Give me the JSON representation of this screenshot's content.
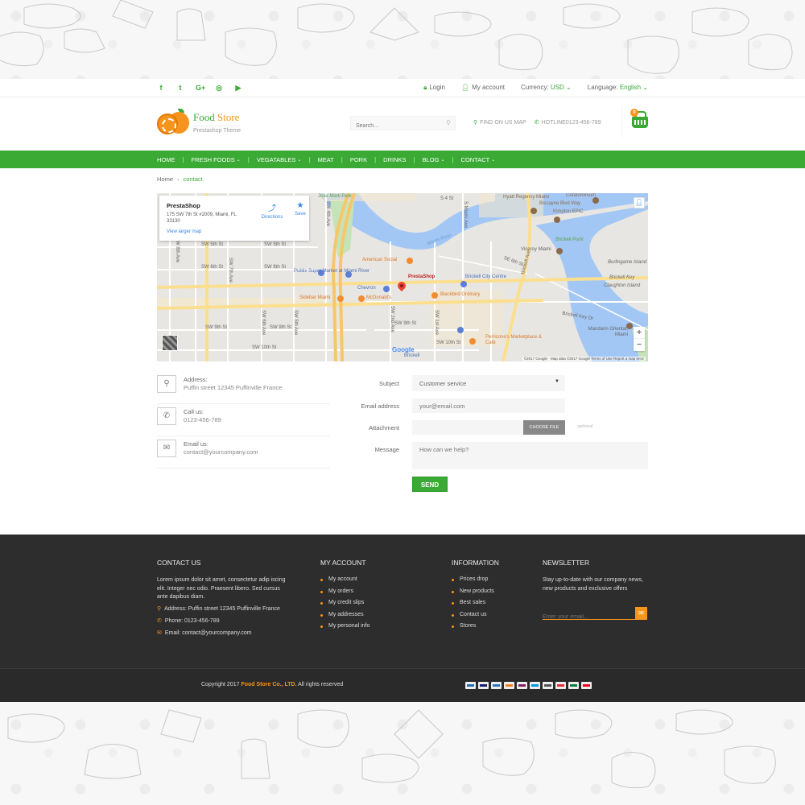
{
  "topbar": {
    "social": [
      {
        "icon": "facebook-icon",
        "glyph": "f"
      },
      {
        "icon": "twitter-icon",
        "glyph": "t"
      },
      {
        "icon": "google-plus-icon",
        "glyph": "G+"
      },
      {
        "icon": "instagram-icon",
        "glyph": "◎"
      },
      {
        "icon": "youtube-icon",
        "glyph": "▶"
      }
    ],
    "login": "Login",
    "my_account": "My account",
    "currency_label": "Currency:",
    "currency_value": "USD",
    "language_label": "Language:",
    "language_value": "English"
  },
  "header": {
    "logo_title_1": "Food",
    "logo_title_2": "Store",
    "logo_subtitle": "Prestashop Theme",
    "search_placeholder": "Search...",
    "find_map": "FIND ON US MAP",
    "hotline": "HOTLINE0123-456-789",
    "cart_count": "0"
  },
  "nav": {
    "items": [
      {
        "label": "HOME",
        "dropdown": false
      },
      {
        "label": "FRESH FOODS",
        "dropdown": true
      },
      {
        "label": "VEGATABLES",
        "dropdown": true
      },
      {
        "label": "MEAT",
        "dropdown": false
      },
      {
        "label": "PORK",
        "dropdown": false
      },
      {
        "label": "DRINKS",
        "dropdown": false
      },
      {
        "label": "BLOG",
        "dropdown": true
      },
      {
        "label": "CONTACT",
        "dropdown": true
      }
    ]
  },
  "breadcrumb": {
    "home": "Home",
    "current": "contact"
  },
  "map": {
    "card_title": "PrestaShop",
    "card_address": "175 SW 7th St #2009, Miami, FL 33130",
    "view_larger": "View larger map",
    "directions": "Directions",
    "save": "Save",
    "pin_label": "PrestaShop",
    "attribution": "©2017 Google · Map data ©2017 Google   Terms of Use   Report a map error",
    "google": "Google",
    "labels": {
      "jose_marti": "Jose Marti Park",
      "hyatt": "Hyatt Regency Miami",
      "condominium": "Condominium",
      "biscayne": "Biscayne Blvd Way",
      "kimpton": "Kimpton EPIC",
      "brickell_point": "Brickell Point",
      "viceroy": "Viceroy Miami",
      "burlingame": "Burlingame Island",
      "brickell_key": "Brickell Key",
      "claughton": "Claughton Island",
      "miami_river": "Miami River",
      "american_social": "American Social",
      "publix": "Publix Super Market at Miami River",
      "chevron": "Chevron",
      "sidebar": "Sidebar Miami",
      "mcdonalds": "McDonald's",
      "brickell_city": "Brickell City Centre",
      "blackbird": "Blackbird Ordinary",
      "pericone": "Perricone's Marketplace & Café",
      "mandarin": "Mandarin Oriental, Miami",
      "brickell_key_dr": "Brickell Key Dr",
      "sw5": "SW 5th St",
      "sw5b": "SW 5th St",
      "sw6": "SW 6th St",
      "sw6b": "SW 6th St",
      "sw9": "SW 9th St",
      "sw9b": "SW 9th St",
      "sw9c": "SW 9th St",
      "sw10": "SW 10th St",
      "sw10b": "SW 10th St",
      "se6": "SE 6th St",
      "s4": "S 4 St",
      "sw8ave": "SW 8th Ave",
      "sw7ave": "SW 7th Ave",
      "sw6ave": "SW 6th Ave",
      "sw5ave": "SW 5th Ave",
      "sw4ave": "SW 4th Ave",
      "sw2ave": "SW 2nd Ave",
      "sw1ave": "SW 1st Ave",
      "smiami": "S Miami Ave",
      "brickell_ave": "Brickell Ave",
      "brickell": "Brickell"
    }
  },
  "contact_info": [
    {
      "icon": "map-marker-icon",
      "glyph": "⚲",
      "label": "Address:",
      "value": "Puffin street 12345 Puffinville France"
    },
    {
      "icon": "phone-icon",
      "glyph": "✆",
      "label": "Call us:",
      "value": "0123-456-789"
    },
    {
      "icon": "envelope-icon",
      "glyph": "✉",
      "label": "Email us:",
      "value": "contact@yourcompany.com"
    }
  ],
  "form": {
    "subject_label": "Subject",
    "subject_value": "Customer service",
    "email_label": "Email address",
    "email_placeholder": "your@email.com",
    "attachment_label": "Attachment",
    "choose_file": "CHOOSE FILE",
    "optional": "optional",
    "message_label": "Message",
    "message_placeholder": "How can we help?",
    "send": "SEND"
  },
  "footer": {
    "contact": {
      "title": "CONTACT US",
      "text": "Lorem ipsum dolor sit amet, consectetur adip iscing elit. Integer nec odio. Praesent libero. Sed cursus ante dapibus diam.",
      "address": "Address: Puffin street 12345 Puffinville France",
      "phone": "Phone: 0123-456-789",
      "email": "Email: contact@yourcompany.com"
    },
    "account": {
      "title": "MY ACCOUNT",
      "links": [
        "My account",
        "My orders",
        "My credit slips",
        "My addresses",
        "My personal info"
      ]
    },
    "information": {
      "title": "INFORMATION",
      "links": [
        "Prices drop",
        "New products",
        "Best sales",
        "Contact us",
        "Stores"
      ]
    },
    "newsletter": {
      "title": "NEWSLETTER",
      "text": "Stay up-to-date with our company news, new products and exclusive offers",
      "placeholder": "Enter your email..."
    },
    "copyright_prefix": "Copyright 2017",
    "copyright_brand": "Food Store Co., LTD.",
    "copyright_suffix": "All rights reserved",
    "payments": [
      "paypal",
      "visa",
      "amex",
      "discover",
      "skrill",
      "maestro",
      "direct-debit",
      "ebay",
      "jcb",
      "mastercard"
    ]
  },
  "colors": {
    "accent": "#3aaa35",
    "secondary": "#f7941d",
    "footer_bg": "#2d2d2d"
  }
}
